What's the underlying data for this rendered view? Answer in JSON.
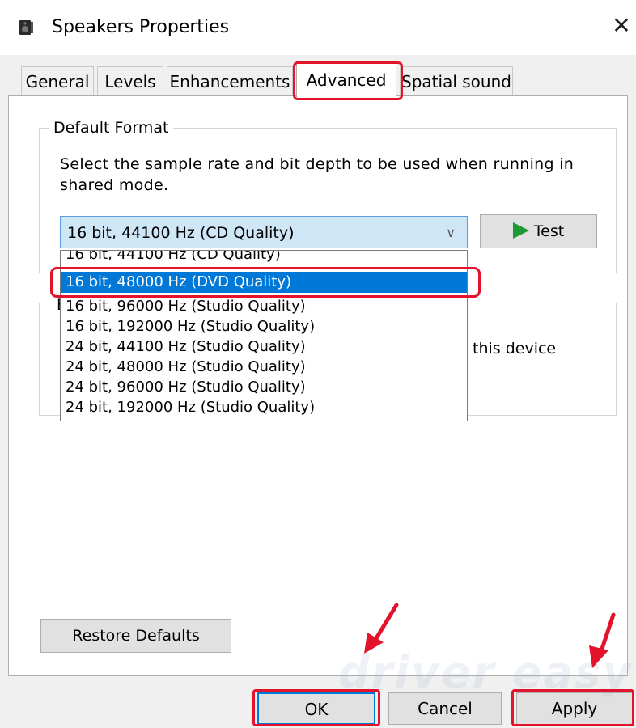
{
  "window": {
    "title": "Speakers Properties",
    "close_glyph": "✕",
    "icon": "speaker-icon"
  },
  "tabs": [
    {
      "label": "General"
    },
    {
      "label": "Levels"
    },
    {
      "label": "Enhancements"
    },
    {
      "label": "Advanced",
      "active": true
    },
    {
      "label": "Spatial sound"
    }
  ],
  "default_format": {
    "group_title": "Default Format",
    "description": "Select the sample rate and bit depth to be used when running in shared mode.",
    "selected_value": "16 bit, 44100 Hz (CD Quality)",
    "test_label": "Test",
    "options": [
      "16 bit, 44100 Hz (CD Quality)",
      "16 bit, 48000 Hz (DVD Quality)",
      "16 bit, 96000 Hz (Studio Quality)",
      "16 bit, 192000 Hz (Studio Quality)",
      "24 bit, 44100 Hz (Studio Quality)",
      "24 bit, 48000 Hz (Studio Quality)",
      "24 bit, 96000 Hz (Studio Quality)",
      "24 bit, 192000 Hz (Studio Quality)"
    ],
    "highlighted_option": "16 bit, 48000 Hz (DVD Quality)"
  },
  "exclusive_group": {
    "visible_letter": "E",
    "visible_text": "this device"
  },
  "buttons": {
    "restore_defaults": "Restore Defaults",
    "ok": "OK",
    "cancel": "Cancel",
    "apply": "Apply"
  },
  "watermark": {
    "text": "driver easy"
  },
  "colors": {
    "highlight": "#e3132c",
    "selection": "#0078d7",
    "combo_bg": "#cfe6f7",
    "play_green": "#1e9a33"
  }
}
